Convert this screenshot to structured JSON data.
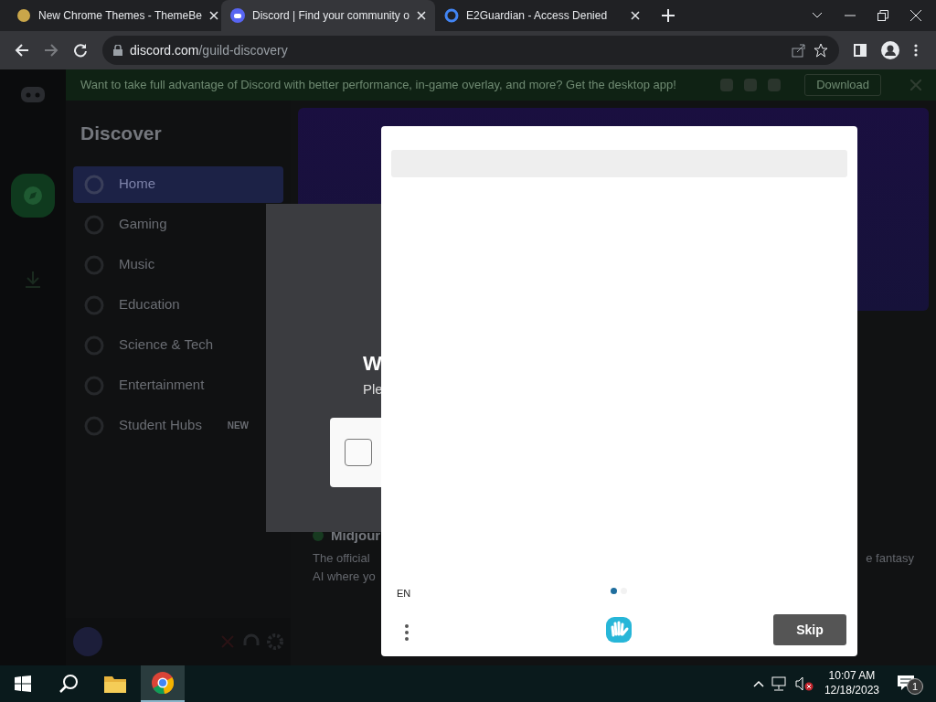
{
  "browser": {
    "tabs": [
      {
        "title": "New Chrome Themes - ThemeBe",
        "selected": false
      },
      {
        "title": "Discord | Find your community o",
        "selected": true
      },
      {
        "title": "E2Guardian - Access Denied",
        "selected": false
      }
    ],
    "address": {
      "domain": "discord.com",
      "path": "/guild-discovery"
    }
  },
  "discord": {
    "banner": {
      "text": "Want to take full advantage of Discord with better performance, in-game overlay, and more? Get the desktop app!",
      "button": "Download"
    },
    "sidebar": {
      "title": "Discover",
      "items": [
        {
          "label": "Home",
          "selected": true
        },
        {
          "label": "Gaming",
          "selected": false
        },
        {
          "label": "Music",
          "selected": false
        },
        {
          "label": "Education",
          "selected": false
        },
        {
          "label": "Science & Tech",
          "selected": false
        },
        {
          "label": "Entertainment",
          "selected": false
        },
        {
          "label": "Student Hubs",
          "selected": false,
          "badge": "NEW"
        }
      ]
    },
    "verify_modal": {
      "heading": "W",
      "text": "Ple",
      "checkbox_checked": false
    },
    "featured": {
      "title": "Midjour",
      "description": [
        "The official",
        "AI where yo"
      ],
      "description_end": "e fantasy"
    }
  },
  "captcha": {
    "language": "EN",
    "pages": [
      {
        "selected": true
      },
      {
        "selected": false
      }
    ],
    "skip": "Skip"
  },
  "taskbar": {
    "time": "10:07 AM",
    "date": "12/18/2023",
    "notifications": "1"
  }
}
